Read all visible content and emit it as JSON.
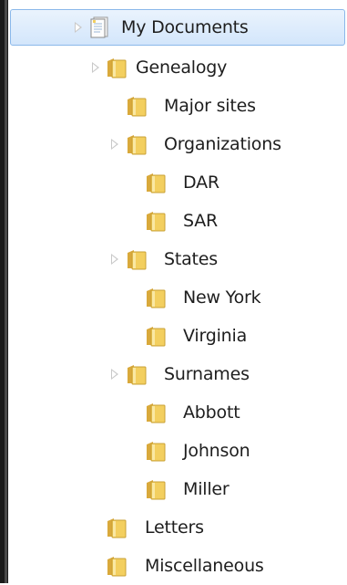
{
  "tree": {
    "root": {
      "label": "My Documents",
      "icon": "documents-library-icon",
      "expander": "collapsed",
      "selected": true
    },
    "items": [
      {
        "label": "Genealogy",
        "icon": "folder-icon",
        "expander": "collapsed"
      },
      {
        "label": "Major sites",
        "icon": "folder-icon",
        "expander": "none"
      },
      {
        "label": "Organizations",
        "icon": "folder-icon",
        "expander": "collapsed"
      },
      {
        "label": "DAR",
        "icon": "folder-icon",
        "expander": "none"
      },
      {
        "label": "SAR",
        "icon": "folder-icon",
        "expander": "none"
      },
      {
        "label": "States",
        "icon": "folder-icon",
        "expander": "collapsed"
      },
      {
        "label": "New York",
        "icon": "folder-icon",
        "expander": "none"
      },
      {
        "label": "Virginia",
        "icon": "folder-icon",
        "expander": "none"
      },
      {
        "label": "Surnames",
        "icon": "folder-icon",
        "expander": "collapsed"
      },
      {
        "label": "Abbott",
        "icon": "folder-icon",
        "expander": "none"
      },
      {
        "label": "Johnson",
        "icon": "folder-icon",
        "expander": "none"
      },
      {
        "label": "Miller",
        "icon": "folder-icon",
        "expander": "none"
      },
      {
        "label": "Letters",
        "icon": "folder-icon",
        "expander": "none"
      },
      {
        "label": "Miscellaneous",
        "icon": "folder-icon",
        "expander": "none"
      }
    ]
  },
  "colors": {
    "selection_border": "#8ab8ea",
    "selection_fill": "#d3e6fb",
    "folder_yellow": "#f3cf5f",
    "text": "#1e1e1e"
  }
}
